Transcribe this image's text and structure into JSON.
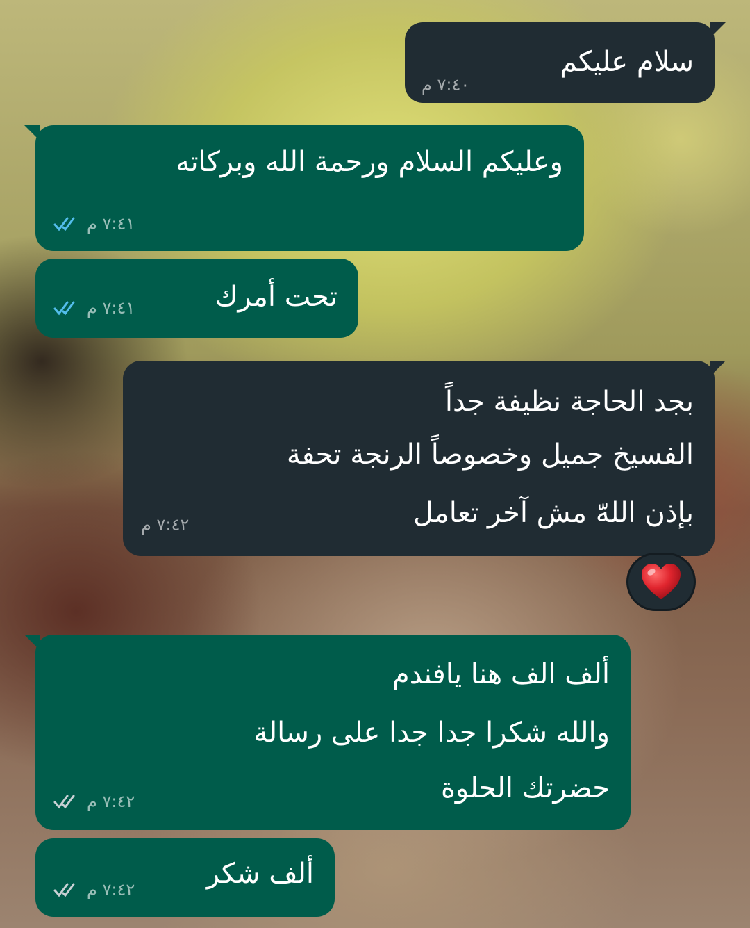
{
  "messages": [
    {
      "id": "m1",
      "direction": "incoming",
      "text": "سلام عليكم",
      "time": "٧:٤٠ م"
    },
    {
      "id": "m2",
      "direction": "outgoing",
      "text": "وعليكم السلام ورحمة الله وبركاته",
      "time": "٧:٤١ م",
      "status": "read"
    },
    {
      "id": "m3",
      "direction": "outgoing",
      "text": "تحت أمرك",
      "time": "٧:٤١ م",
      "status": "read"
    },
    {
      "id": "m4",
      "direction": "incoming",
      "lines": [
        "بجد الحاجة نظيفة جداً",
        "الفسيخ جميل وخصوصاً الرنجة تحفة",
        "بإذن اللهّ مش آخر تعامل"
      ],
      "time": "٧:٤٢ م",
      "reaction": "❤️"
    },
    {
      "id": "m5",
      "direction": "outgoing",
      "lines": [
        "ألف الف هنا يافندم",
        "والله شكرا جدا جدا على رسالة",
        "حضرتك الحلوة"
      ],
      "time": "٧:٤٢ م",
      "status": "delivered"
    },
    {
      "id": "m6",
      "direction": "outgoing",
      "text": "ألف شكر",
      "time": "٧:٤٢ م",
      "status": "delivered"
    }
  ],
  "colors": {
    "outgoing_bubble": "#005c4b",
    "incoming_bubble": "#202c33",
    "read_tick": "#53bdeb",
    "delivered_tick": "#8696a0",
    "heart": "#e0252e"
  },
  "icons": {
    "read": "double-check-icon",
    "delivered": "double-check-icon",
    "reaction": "heart-icon"
  }
}
